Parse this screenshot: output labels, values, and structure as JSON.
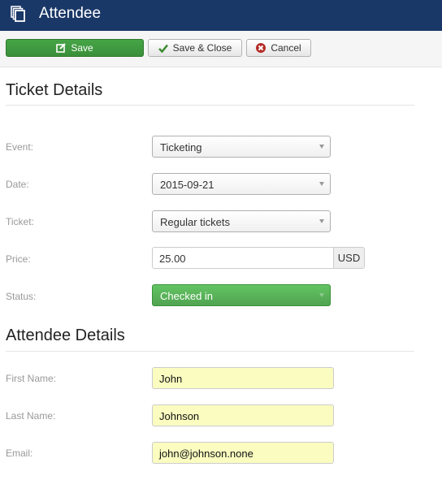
{
  "header": {
    "title": "Attendee",
    "icon": "copy-icon"
  },
  "toolbar": {
    "save_label": "Save",
    "save_close_label": "Save & Close",
    "cancel_label": "Cancel"
  },
  "ticket_details": {
    "heading": "Ticket Details",
    "event": {
      "label": "Event:",
      "value": "Ticketing"
    },
    "date": {
      "label": "Date:",
      "value": "2015-09-21"
    },
    "ticket": {
      "label": "Ticket:",
      "value": "Regular tickets"
    },
    "price": {
      "label": "Price:",
      "value": "25.00",
      "currency": "USD"
    },
    "status": {
      "label": "Status:",
      "value": "Checked in",
      "color": "#5cb85c"
    }
  },
  "attendee_details": {
    "heading": "Attendee Details",
    "first_name": {
      "label": "First Name:",
      "value": "John"
    },
    "last_name": {
      "label": "Last Name:",
      "value": "Johnson"
    },
    "email": {
      "label": "Email:",
      "value": "john@johnson.none"
    }
  }
}
